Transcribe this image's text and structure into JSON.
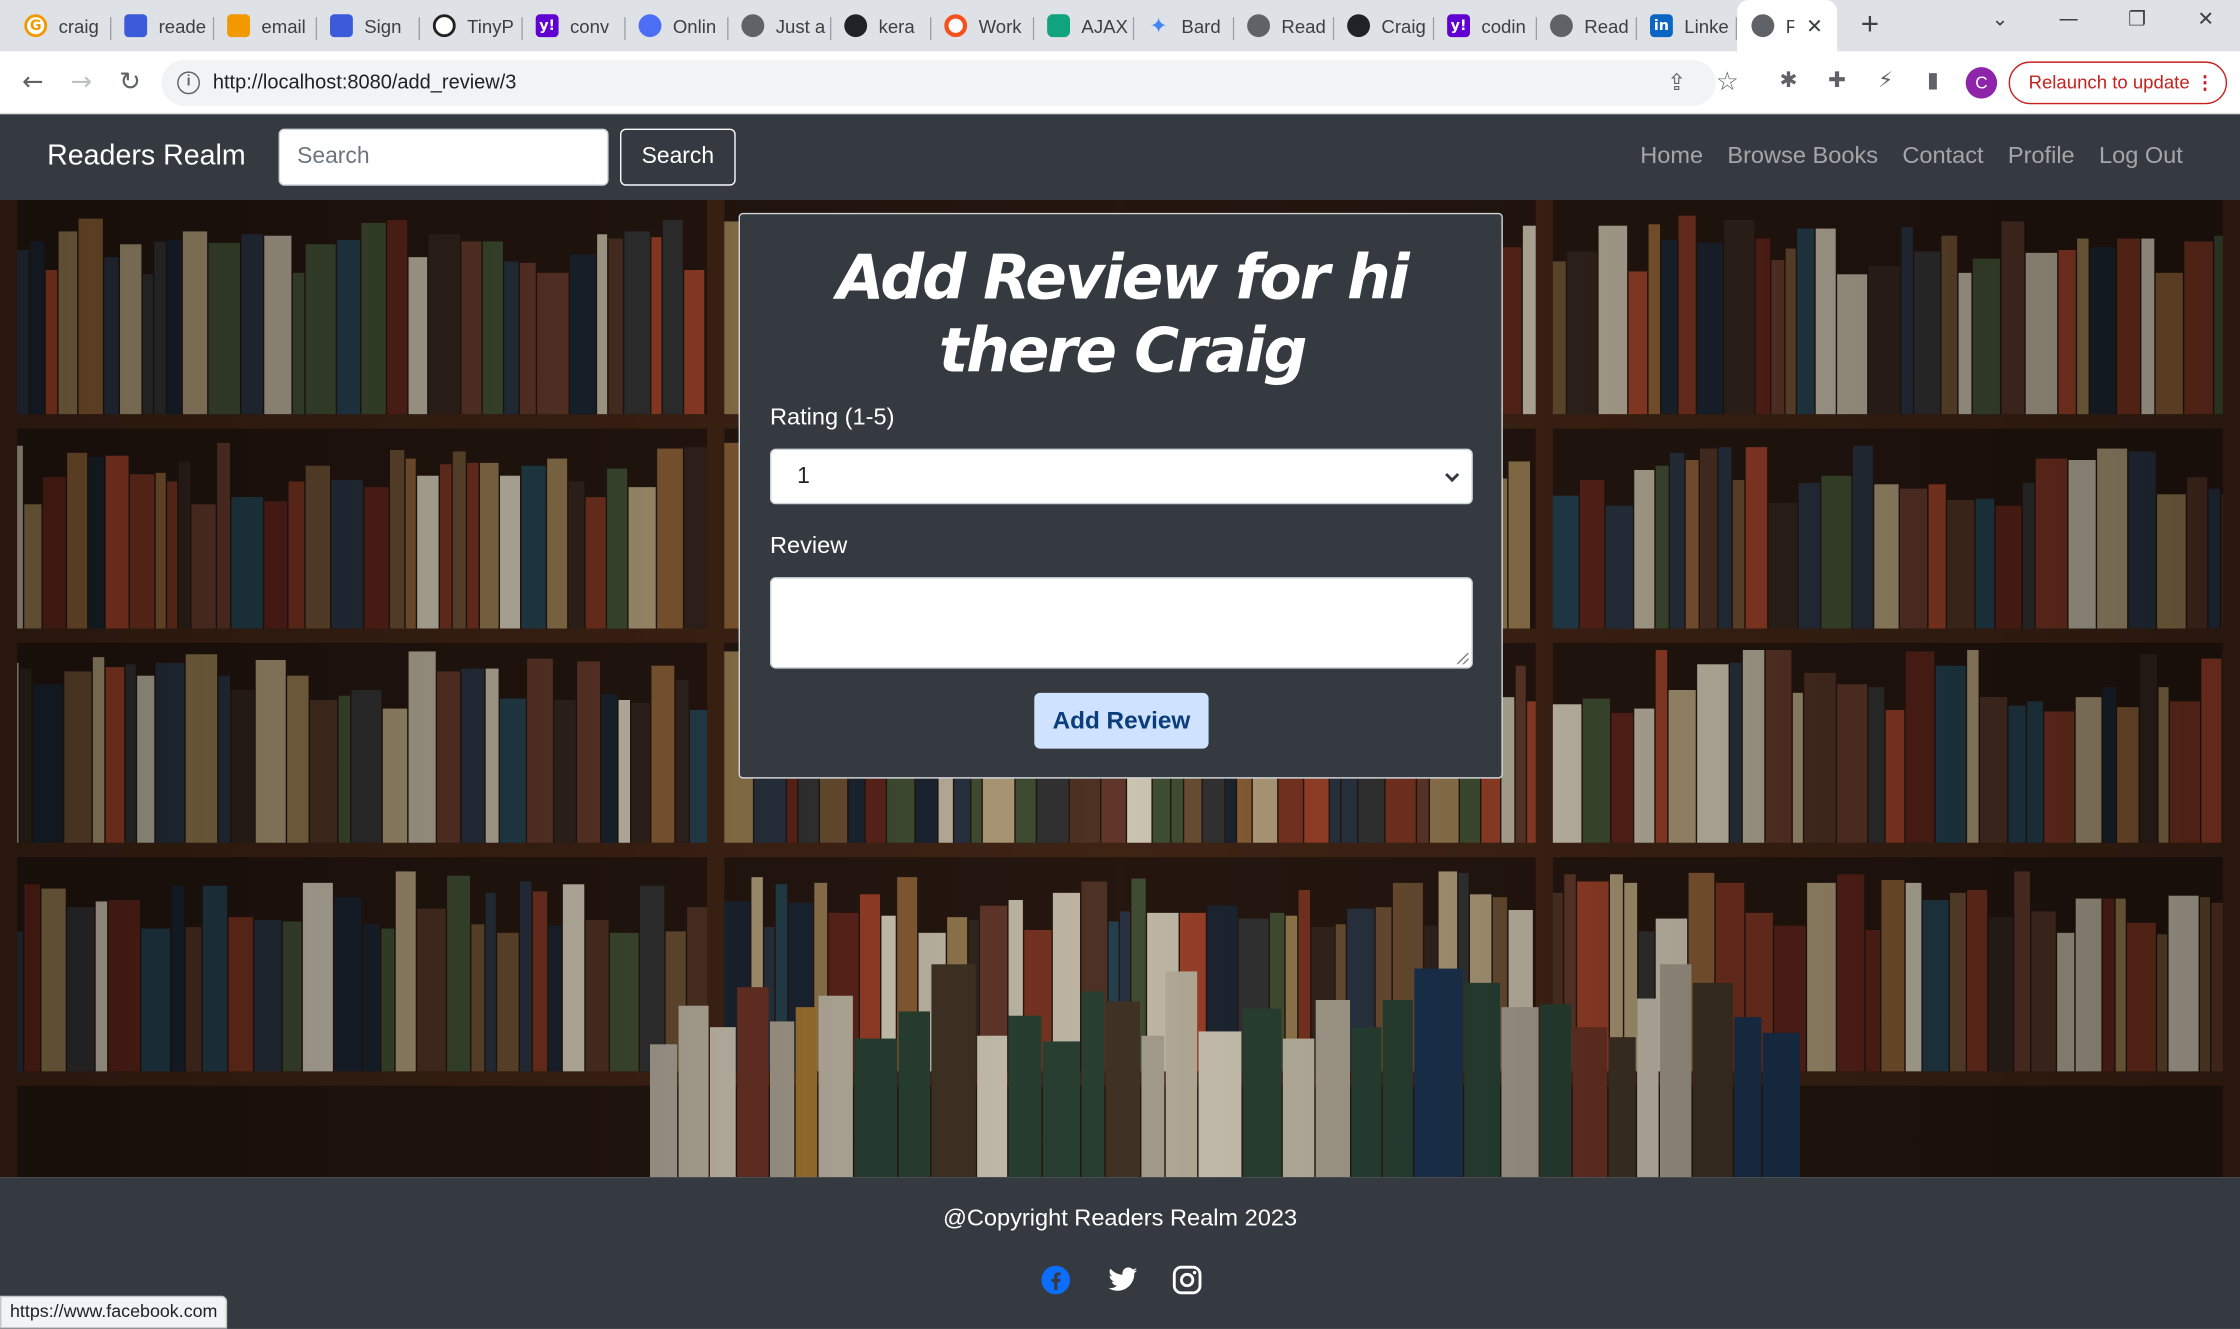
{
  "browser": {
    "tabs": [
      {
        "label": "craig",
        "icon": "google-icon",
        "color": "#f29900"
      },
      {
        "label": "reade",
        "icon": "shield-icon",
        "color": "#3b5bdb"
      },
      {
        "label": "email",
        "icon": "shield-icon",
        "color": "#f29900"
      },
      {
        "label": "Sign",
        "icon": "shield-icon",
        "color": "#3b5bdb"
      },
      {
        "label": "TinyP",
        "icon": "panda-icon",
        "color": "#222222"
      },
      {
        "label": "conv",
        "icon": "yahoo-icon",
        "color": "#6001d2"
      },
      {
        "label": "Onlin",
        "icon": "circle-icon",
        "color": "#4c6ef5"
      },
      {
        "label": "Just a",
        "icon": "globe-icon",
        "color": "#5f6368"
      },
      {
        "label": "kera",
        "icon": "github-icon",
        "color": "#1f2328"
      },
      {
        "label": "Work",
        "icon": "ring-icon",
        "color": "#f4511e"
      },
      {
        "label": "AJAX",
        "icon": "openai-icon",
        "color": "#10a37f"
      },
      {
        "label": "Bard",
        "icon": "sparkle-icon",
        "color": "#4285f4"
      },
      {
        "label": "Read",
        "icon": "globe-icon",
        "color": "#5f6368"
      },
      {
        "label": "Craig",
        "icon": "github-icon",
        "color": "#1f2328"
      },
      {
        "label": "codin",
        "icon": "yahoo-icon",
        "color": "#6001d2"
      },
      {
        "label": "Read",
        "icon": "globe-icon",
        "color": "#5f6368"
      },
      {
        "label": "Linke",
        "icon": "linkedin-icon",
        "color": "#0a66c2"
      }
    ],
    "active_tab_label": "F",
    "url": "http://localhost:8080/add_review/3",
    "relaunch_label": "Relaunch to update",
    "profile_initial": "C",
    "status_url": "https://www.facebook.com"
  },
  "nav": {
    "brand": "Readers Realm",
    "search_placeholder": "Search",
    "search_button": "Search",
    "links": [
      "Home",
      "Browse Books",
      "Contact",
      "Profile",
      "Log Out"
    ]
  },
  "form": {
    "title": "Add Review for hi there Craig",
    "rating_label": "Rating (1-5)",
    "rating_value": "1",
    "review_label": "Review",
    "review_value": "",
    "submit_label": "Add Review"
  },
  "footer": {
    "copyright": "@Copyright Readers Realm 2023",
    "social": [
      "facebook-icon",
      "twitter-icon",
      "instagram-icon"
    ]
  },
  "colors": {
    "navbar_bg": "#343a40",
    "button_bg": "#cfe2ff",
    "relaunch": "#c5221f"
  }
}
